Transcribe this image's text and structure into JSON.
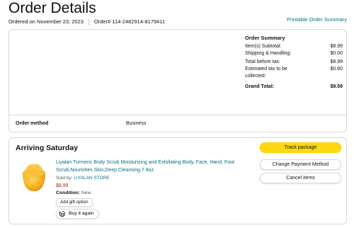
{
  "header": {
    "title": "Order Details",
    "ordered_on": "Ordered on November 23, 2023",
    "order_number": "Order# 114-2482914-8179411",
    "printable_link": "Printable Order Summary"
  },
  "summary": {
    "title": "Order Summary",
    "rows": [
      {
        "label": "Item(s) Subtotal:",
        "value": "$8.99"
      },
      {
        "label": "Shipping & Handling:",
        "value": "$0.00"
      },
      {
        "label": "Total before tax:",
        "value": "$8.99"
      },
      {
        "label": "Estimated tax to be collected:",
        "value": "$0.60"
      }
    ],
    "grand_total_label": "Grand Total:",
    "grand_total_value": "$9.59"
  },
  "order_method": {
    "label": "Order method",
    "value": "Business"
  },
  "shipment": {
    "heading": "Arriving Saturday",
    "product": {
      "title": "Liyalan Turmeric Body Scrub Moisturizing and Exfoliating Body, Face, Hand, Foot Scrub,Nourishes Skin,Deep Cleansing 7.8oz",
      "sold_by_prefix": "Sold by: ",
      "seller": "LIYALAN STORE",
      "price": "$8.99",
      "condition_label": "Condition:",
      "condition_value": " New",
      "image_icon": "turmeric-scrub-jar"
    },
    "gift_option_label": "Add gift option",
    "buy_again_label": "Buy it again",
    "buttons": {
      "track": "Track package",
      "change_payment": "Change Payment Method",
      "cancel": "Cancel items"
    }
  },
  "colors": {
    "link": "#007185",
    "price": "#b12704",
    "primary_button": "#ffd814",
    "border": "#d5d9d9"
  }
}
